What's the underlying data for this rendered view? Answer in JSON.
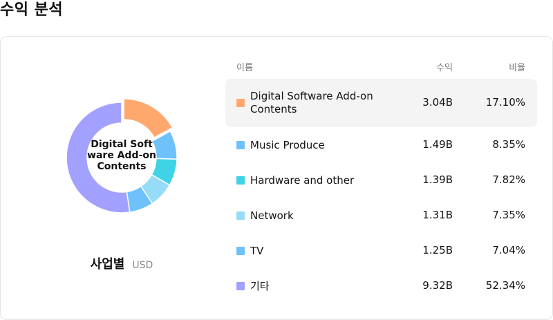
{
  "page": {
    "title": "수익 분석"
  },
  "chart": {
    "center_label": "Digital Software Add-on Contents",
    "caption": "사업별",
    "unit": "USD"
  },
  "table": {
    "headers": {
      "name": "이름",
      "revenue": "수익",
      "ratio": "비율"
    },
    "rows": [
      {
        "name": "Digital Software Add-on Contents",
        "revenue": "3.04B",
        "ratio": "17.10%",
        "color": "#FFA86E",
        "selected": true
      },
      {
        "name": "Music Produce",
        "revenue": "1.49B",
        "ratio": "8.35%",
        "color": "#6EC1FA",
        "selected": false
      },
      {
        "name": "Hardware and other",
        "revenue": "1.39B",
        "ratio": "7.82%",
        "color": "#3FD3E6",
        "selected": false
      },
      {
        "name": "Network",
        "revenue": "1.31B",
        "ratio": "7.35%",
        "color": "#96DBF7",
        "selected": false
      },
      {
        "name": "TV",
        "revenue": "1.25B",
        "ratio": "7.04%",
        "color": "#6EC1FA",
        "selected": false
      },
      {
        "name": "기타",
        "revenue": "9.32B",
        "ratio": "52.34%",
        "color": "#A3A1FF",
        "selected": false
      }
    ]
  },
  "chart_data": {
    "type": "pie",
    "categories": [
      "Digital Software Add-on Contents",
      "Music Produce",
      "Hardware and other",
      "Network",
      "TV",
      "기타"
    ],
    "values": [
      17.1,
      8.35,
      7.82,
      7.35,
      7.04,
      52.34
    ],
    "colors": [
      "#FFA86E",
      "#6EC1FA",
      "#3FD3E6",
      "#96DBF7",
      "#6EC1FA",
      "#A3A1FF"
    ],
    "selected_index": 0
  }
}
